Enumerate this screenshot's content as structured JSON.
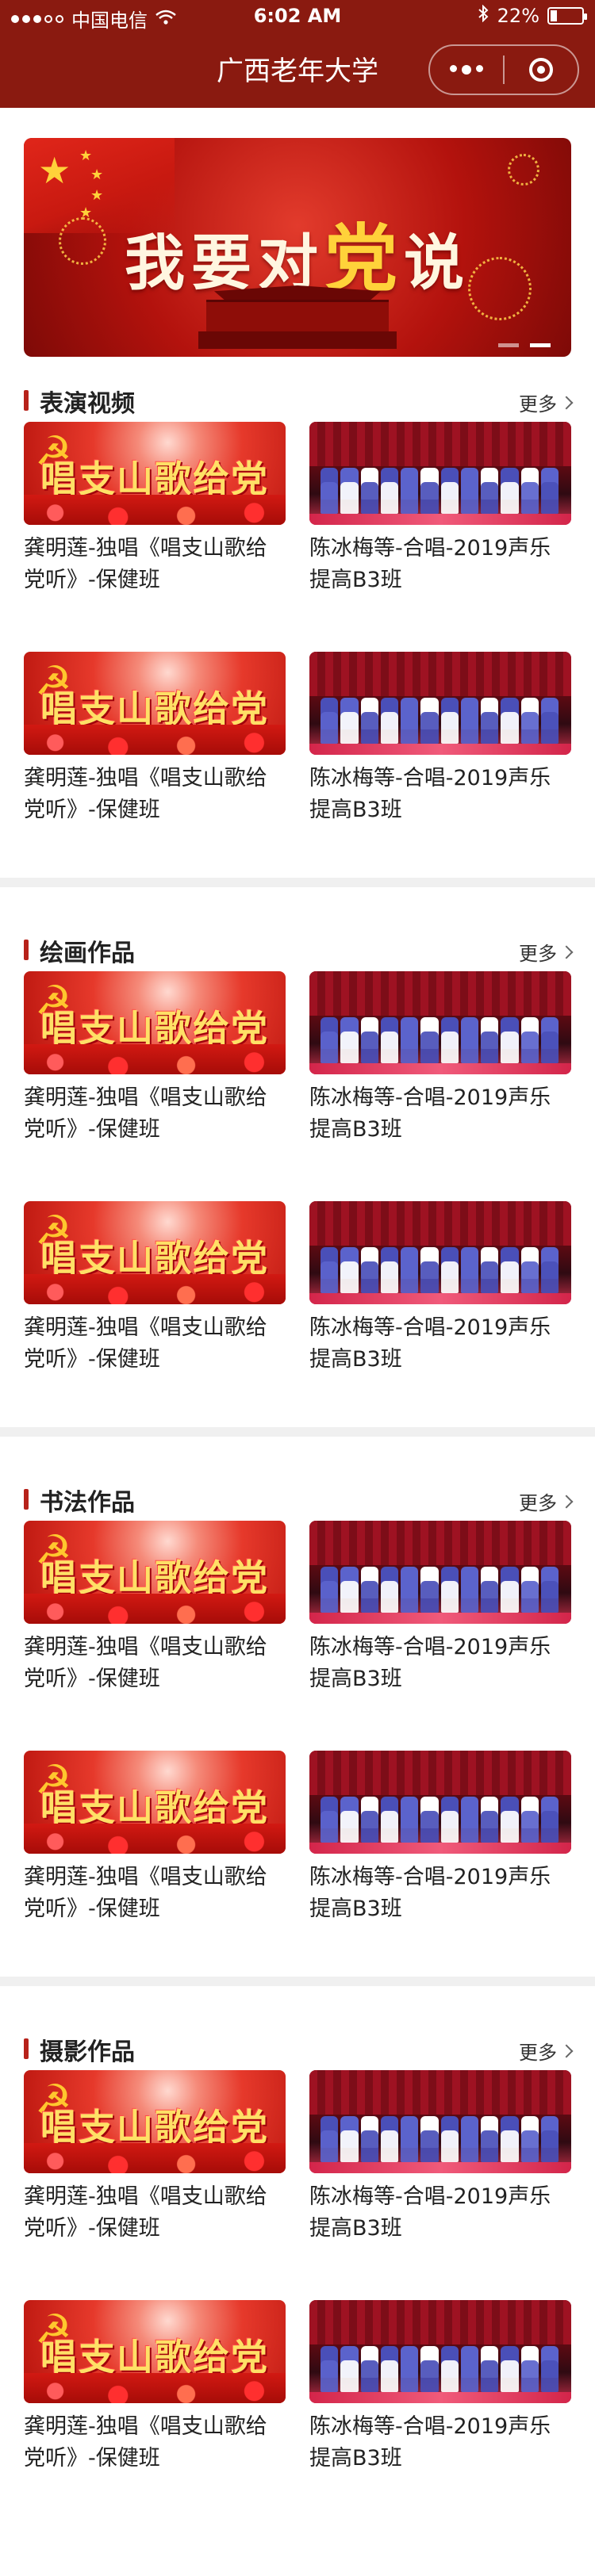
{
  "status_bar": {
    "carrier": "中国电信",
    "time": "6:02 AM",
    "battery": "22%",
    "battery_level": 0.22
  },
  "nav": {
    "title": "广西老年大学"
  },
  "banner": {
    "headline_pre": "我要对",
    "headline_key": "党",
    "headline_post": "说"
  },
  "more_label": "更多",
  "sections": [
    {
      "title": "表演视频",
      "items": [
        {
          "thumb_text": "唱支山歌给党听",
          "caption": "龚明莲-独唱《唱支山歌给党听》-保健班"
        },
        {
          "caption": "陈冰梅等-合唱-2019声乐提高B3班"
        },
        {
          "thumb_text": "唱支山歌给党听",
          "caption": "龚明莲-独唱《唱支山歌给党听》-保健班"
        },
        {
          "caption": "陈冰梅等-合唱-2019声乐提高B3班"
        }
      ]
    },
    {
      "title": "绘画作品",
      "items": [
        {
          "thumb_text": "唱支山歌给党听",
          "caption": "龚明莲-独唱《唱支山歌给党听》-保健班"
        },
        {
          "caption": "陈冰梅等-合唱-2019声乐提高B3班"
        },
        {
          "thumb_text": "唱支山歌给党听",
          "caption": "龚明莲-独唱《唱支山歌给党听》-保健班"
        },
        {
          "caption": "陈冰梅等-合唱-2019声乐提高B3班"
        }
      ]
    },
    {
      "title": "书法作品",
      "items": [
        {
          "thumb_text": "唱支山歌给党听",
          "caption": "龚明莲-独唱《唱支山歌给党听》-保健班"
        },
        {
          "caption": "陈冰梅等-合唱-2019声乐提高B3班"
        },
        {
          "thumb_text": "唱支山歌给党听",
          "caption": "龚明莲-独唱《唱支山歌给党听》-保健班"
        },
        {
          "caption": "陈冰梅等-合唱-2019声乐提高B3班"
        }
      ]
    },
    {
      "title": "摄影作品",
      "items": [
        {
          "thumb_text": "唱支山歌给党听",
          "caption": "龚明莲-独唱《唱支山歌给党听》-保健班"
        },
        {
          "caption": "陈冰梅等-合唱-2019声乐提高B3班"
        },
        {
          "thumb_text": "唱支山歌给党听",
          "caption": "龚明莲-独唱《唱支山歌给党听》-保健班"
        },
        {
          "caption": "陈冰梅等-合唱-2019声乐提高B3班"
        }
      ]
    }
  ],
  "colors": {
    "header_bg": "#8a1a10",
    "accent": "#b7221a",
    "divider": "#f0f0f0"
  }
}
